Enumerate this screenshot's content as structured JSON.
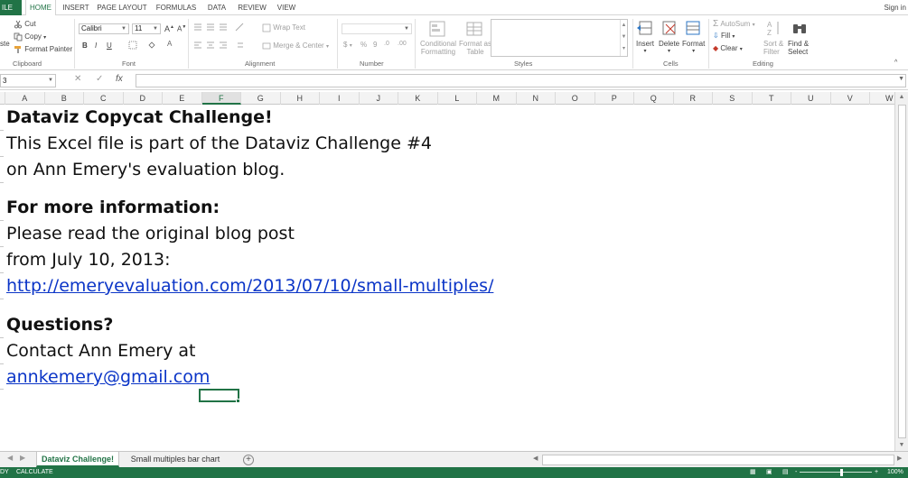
{
  "ribbon_tabs": {
    "file": "ILE",
    "home": "HOME",
    "insert": "INSERT",
    "page_layout": "PAGE LAYOUT",
    "formulas": "FORMULAS",
    "data": "DATA",
    "review": "REVIEW",
    "view": "VIEW",
    "sign_in": "Sign in"
  },
  "clipboard": {
    "paste": "ste",
    "cut": "Cut",
    "copy": "Copy",
    "format_painter": "Format Painter",
    "label": "Clipboard"
  },
  "font": {
    "family": "Calibri",
    "size": "11",
    "bold": "B",
    "italic": "I",
    "underline": "U",
    "label": "Font"
  },
  "alignment": {
    "wrap_text": "Wrap Text",
    "merge_center": "Merge & Center",
    "label": "Alignment"
  },
  "number": {
    "currency": "$",
    "percent": "%",
    "comma": "9",
    "label": "Number"
  },
  "styles": {
    "conditional_line1": "Conditional",
    "conditional_line2": "Formatting",
    "format_table_line1": "Format as",
    "format_table_line2": "Table",
    "label": "Styles"
  },
  "cells": {
    "insert": "Insert",
    "delete": "Delete",
    "format": "Format",
    "label": "Cells"
  },
  "editing": {
    "autosum": "AutoSum",
    "fill": "Fill",
    "clear": "Clear",
    "sort_line1": "Sort &",
    "sort_line2": "Filter",
    "find_line1": "Find &",
    "find_line2": "Select",
    "label": "Editing"
  },
  "formula_bar": {
    "name_box": "3",
    "fx": "fx",
    "formula": ""
  },
  "columns": [
    "A",
    "B",
    "C",
    "D",
    "E",
    "F",
    "G",
    "H",
    "I",
    "J",
    "K",
    "L",
    "M",
    "N",
    "O",
    "P",
    "Q",
    "R",
    "S",
    "T",
    "U",
    "V",
    "W"
  ],
  "selected_column": "F",
  "content": {
    "title": "Dataviz Copycat Challenge!",
    "line1": "This Excel file is part of the Dataviz Challenge #4",
    "line2": "on Ann Emery's evaluation blog.",
    "info_heading": "For more information:",
    "info_line1": "Please read the original blog post",
    "info_line2": "from July 10, 2013:",
    "link": "http://emeryevaluation.com/2013/07/10/small-multiples/",
    "questions_heading": "Questions?",
    "contact_line": "Contact Ann Emery at",
    "email": "annkemery@gmail.com "
  },
  "sheets": {
    "active": "Dataviz Challenge!",
    "second": "Small multiples bar chart",
    "add": "+"
  },
  "status": {
    "ready": "DY",
    "calculate": "CALCULATE",
    "zoom": "100%",
    "minus": "-",
    "plus": "+"
  },
  "accent_color": "#217346",
  "link_color": "#0b35c7"
}
